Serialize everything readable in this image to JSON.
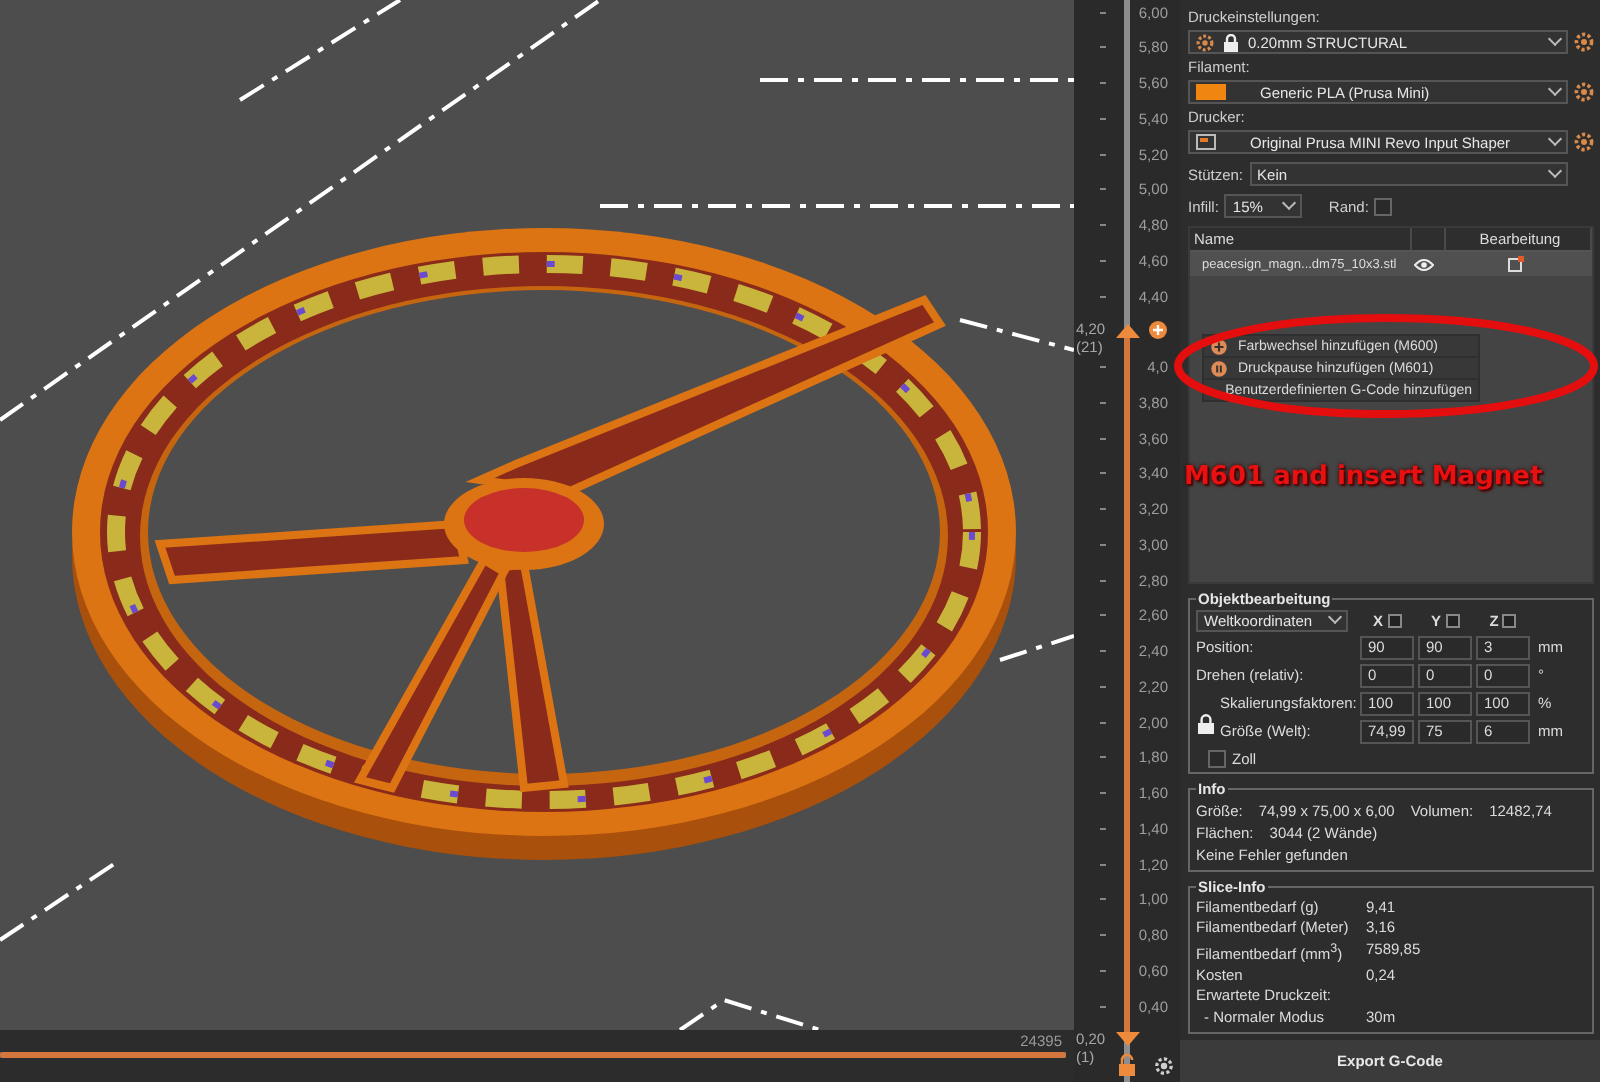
{
  "viewport": {
    "annotation": "M601 and insert Magnet"
  },
  "move_slider": {
    "level": 1,
    "value": "24395"
  },
  "layer_slider": {
    "ticks": [
      {
        "label": "6,00",
        "kind": "tick"
      },
      {
        "label": "5,80",
        "kind": "tick"
      },
      {
        "label": "5,60",
        "kind": "tick"
      },
      {
        "label": "5,40",
        "kind": "tick"
      },
      {
        "label": "5,20",
        "kind": "tick"
      },
      {
        "label": "5,00",
        "kind": "tick"
      },
      {
        "label": "4,80",
        "kind": "tick"
      },
      {
        "label": "4,60",
        "kind": "tick"
      },
      {
        "label": "4,40",
        "kind": "tick"
      },
      {
        "label": "4,20",
        "layer": "(21)",
        "kind": "upper-thumb",
        "level": 0.69
      },
      {
        "label": "4,0",
        "kind": "tick"
      },
      {
        "label": "3,80",
        "kind": "tick"
      },
      {
        "label": "3,60",
        "kind": "tick"
      },
      {
        "label": "3,40",
        "kind": "tick"
      },
      {
        "label": "3,20",
        "kind": "tick"
      },
      {
        "label": "3,00",
        "kind": "tick"
      },
      {
        "label": "2,80",
        "kind": "tick"
      },
      {
        "label": "2,60",
        "kind": "tick"
      },
      {
        "label": "2,40",
        "kind": "tick"
      },
      {
        "label": "2,20",
        "kind": "tick"
      },
      {
        "label": "2,00",
        "kind": "tick"
      },
      {
        "label": "1,80",
        "kind": "tick"
      },
      {
        "label": "1,60",
        "kind": "tick"
      },
      {
        "label": "1,40",
        "kind": "tick"
      },
      {
        "label": "1,20",
        "kind": "tick"
      },
      {
        "label": "1,00",
        "kind": "tick"
      },
      {
        "label": "0,80",
        "kind": "tick"
      },
      {
        "label": "0,60",
        "kind": "tick"
      },
      {
        "label": "0,40",
        "kind": "tick"
      },
      {
        "label": "0,20",
        "layer": "(1)",
        "kind": "lower-thumb",
        "level": 0
      }
    ]
  },
  "context_menu": [
    {
      "label": "Farbwechsel hinzufügen (M600)",
      "kind": "color-change"
    },
    {
      "label": "Druckpause hinzufügen (M601)",
      "kind": "pause"
    },
    {
      "label": "Benutzerdefinierten G-Code hinzufügen",
      "kind": "custom"
    }
  ],
  "print_settings": {
    "label": "Druckeinstellungen:",
    "value": "0.20mm STRUCTURAL",
    "locked": true
  },
  "filament": {
    "label": "Filament:",
    "value": "Generic PLA (Prusa Mini)",
    "color": "#f0860f"
  },
  "printer": {
    "label": "Drucker:",
    "value": "Original Prusa MINI Revo Input Shaper"
  },
  "supports": {
    "label": "Stützen:",
    "value": "Kein"
  },
  "infill": {
    "label": "Infill:",
    "value": "15%"
  },
  "brim": {
    "label": "Rand:",
    "checked": false
  },
  "object_list": {
    "columns": [
      "Name",
      "Bearbeitung"
    ],
    "rows": [
      {
        "name": "peacesign_magn...dm75_10x3.stl",
        "visible": true
      }
    ]
  },
  "object_manipulation": {
    "title": "Objektbearbeitung",
    "coordinates": "Weltkoordinaten",
    "axes": [
      "X",
      "Y",
      "Z"
    ],
    "rows": [
      {
        "label": "Position:",
        "values": [
          "90",
          "90",
          "3"
        ],
        "unit": "mm",
        "kind": "plain"
      },
      {
        "label": "Drehen (relativ):",
        "values": [
          "0",
          "0",
          "0"
        ],
        "unit": "°",
        "kind": "plain"
      },
      {
        "label": "Skalierungsfaktoren:",
        "values": [
          "100",
          "100",
          "100"
        ],
        "unit": "%",
        "kind": "scale"
      },
      {
        "label": "Größe (Welt):",
        "values": [
          "74,99",
          "75",
          "6"
        ],
        "unit": "mm",
        "kind": "scale"
      }
    ],
    "scale_locked": true,
    "inches": {
      "label": "Zoll",
      "checked": false
    }
  },
  "info": {
    "title": "Info",
    "size_label": "Größe:",
    "size": "74,99 x 75,00 x 6,00",
    "volume_label": "Volumen:",
    "volume": "12482,74",
    "faces_label": "Flächen:",
    "faces": "3044 (2 Wände)",
    "status": "Keine Fehler gefunden"
  },
  "slice_info": {
    "title": "Slice-Info",
    "rows": [
      {
        "label": "Filamentbedarf (g)",
        "value": "9,41"
      },
      {
        "label": "Filamentbedarf (Meter)",
        "value": "3,16"
      },
      {
        "label": "Filamentbedarf (mm$^{3}$)",
        "value": "7589,85"
      },
      {
        "label": "Kosten",
        "value": "0,24"
      }
    ],
    "time_label": "Erwartete Druckzeit:",
    "mode": {
      "label": "- Normaler Modus",
      "value": "30m"
    }
  },
  "export_button": "Export G-Code"
}
